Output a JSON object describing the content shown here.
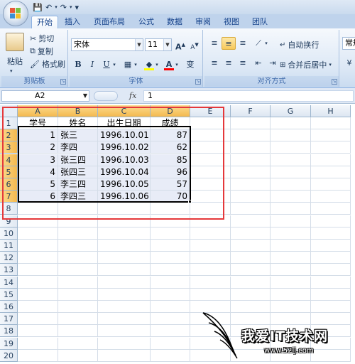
{
  "quick_access": {
    "save": "💾",
    "undo": "↶",
    "redo": "↷",
    "customize": "▾"
  },
  "tabs": [
    "开始",
    "插入",
    "页面布局",
    "公式",
    "数据",
    "审阅",
    "视图",
    "团队"
  ],
  "active_tab": "开始",
  "clipboard": {
    "paste": "粘贴",
    "cut": "剪切",
    "copy": "复制",
    "format_painter": "格式刷",
    "label": "剪贴板"
  },
  "font": {
    "name": "宋体",
    "size": "11",
    "grow": "A",
    "shrink": "A",
    "bold": "B",
    "italic": "I",
    "underline": "U",
    "phonetic": "变",
    "label": "字体",
    "fill_color": "#ffff00",
    "font_color": "#ff0000"
  },
  "alignment": {
    "wrap_text": "自动换行",
    "merge_center": "合并后居中",
    "label": "对齐方式"
  },
  "number": {
    "format": "常规"
  },
  "formula_bar": {
    "name_box": "A2",
    "fx": "fx",
    "value": "1"
  },
  "columns": [
    "A",
    "B",
    "C",
    "D",
    "E",
    "F",
    "G",
    "H"
  ],
  "rows": [
    "1",
    "2",
    "3",
    "4",
    "5",
    "6",
    "7",
    "8",
    "9",
    "10",
    "11",
    "12",
    "13",
    "14",
    "15",
    "16",
    "17",
    "18",
    "19",
    "20"
  ],
  "sheet": {
    "headers": [
      "学号",
      "姓名",
      "出生日期",
      "成绩"
    ],
    "records": [
      [
        "1",
        "张三",
        "1996.10.01",
        "87"
      ],
      [
        "2",
        "李四",
        "1996.10.02",
        "62"
      ],
      [
        "3",
        "张三四",
        "1996.10.03",
        "85"
      ],
      [
        "4",
        "张四三",
        "1996.10.04",
        "96"
      ],
      [
        "5",
        "李三四",
        "1996.10.05",
        "57"
      ],
      [
        "6",
        "李四三",
        "1996.10.06",
        "70"
      ]
    ]
  },
  "watermark": {
    "text": "我爱IT技术网",
    "url": "www.52ij.com"
  },
  "colors": {
    "highlight_header": "#f4b94f",
    "selection_fill": "#e8ecf7",
    "annotation_red": "#e5383b"
  }
}
